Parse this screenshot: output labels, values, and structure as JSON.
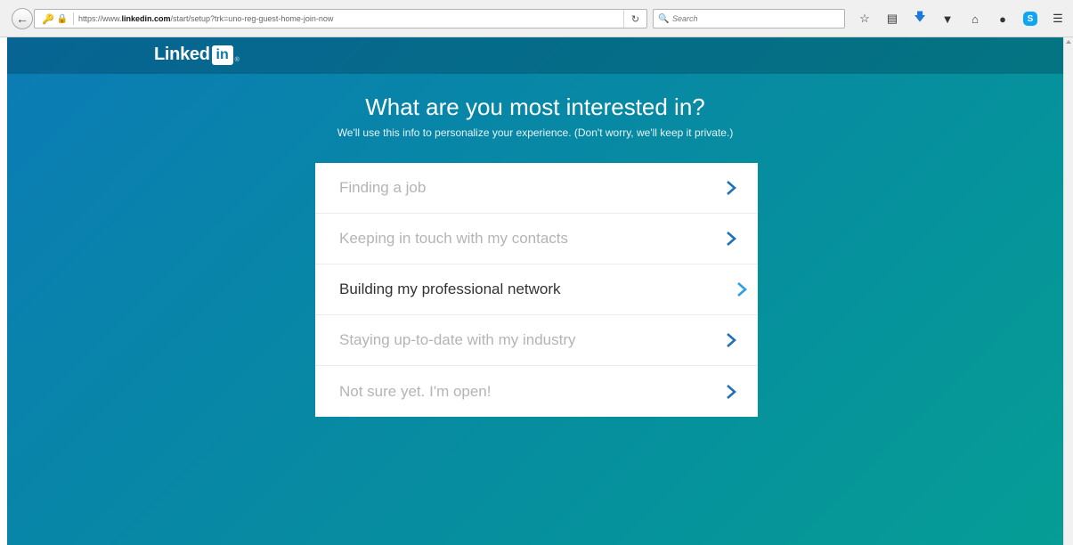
{
  "browser": {
    "url_prefix": "https://www.",
    "url_domain": "linkedin.com",
    "url_path": "/start/setup?trk=uno-reg-guest-home-join-now",
    "search_placeholder": "Search",
    "icons": [
      "star-icon",
      "clipboard-icon",
      "download-icon",
      "pocket-icon",
      "home-icon",
      "chat-icon",
      "skype-icon",
      "menu-icon"
    ]
  },
  "page": {
    "logo_word": "Linked",
    "logo_box": "in",
    "logo_reg": "®",
    "heading": "What are you most interested in?",
    "subheading": "We'll use this info to personalize your experience. (Don't worry, we'll keep it private.)",
    "options": [
      {
        "label": "Finding a job",
        "active": false
      },
      {
        "label": "Keeping in touch with my contacts",
        "active": false
      },
      {
        "label": "Building my professional network",
        "active": true
      },
      {
        "label": "Staying up-to-date with my industry",
        "active": false
      },
      {
        "label": "Not sure yet. I'm open!",
        "active": false
      }
    ]
  },
  "colors": {
    "chevron": "#1f72b8",
    "chevron_active": "#2aa1e0",
    "background_start": "#0b7cb5",
    "background_end": "#059d95"
  }
}
